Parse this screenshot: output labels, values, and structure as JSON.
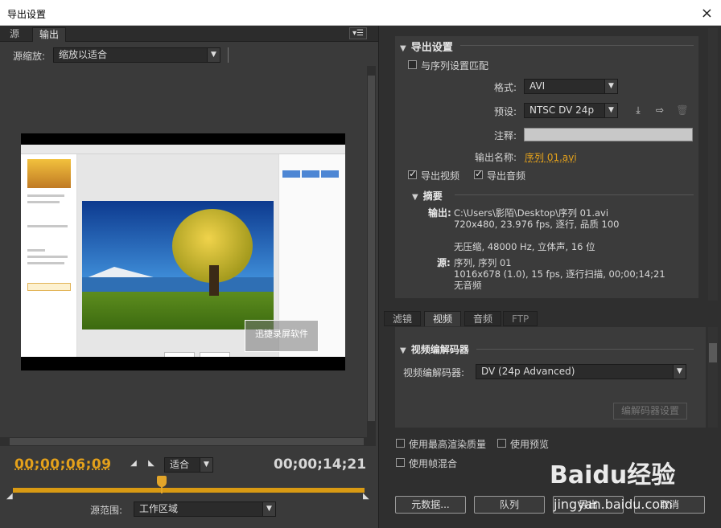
{
  "window": {
    "title": "导出设置",
    "close_glyph": "×"
  },
  "left": {
    "tabs": [
      "源",
      "输出"
    ],
    "active_tab": "输出",
    "menu_glyph": "▾☰",
    "source_scale_label": "源缩放:",
    "source_scale_value": "缩放以适合",
    "watermark_text": "迅捷录屏软件",
    "timecode_current": "00;00;06;09",
    "timecode_end": "00;00;14;21",
    "fit_value": "适合",
    "source_range_label": "源范围:",
    "source_range_value": "工作区域"
  },
  "export_settings": {
    "section_title": "导出设置",
    "match_sequence_label": "与序列设置匹配",
    "format_label": "格式:",
    "format_value": "AVI",
    "preset_label": "预设:",
    "preset_value": "NTSC DV 24p",
    "comment_label": "注释:",
    "output_name_label": "输出名称:",
    "output_name_value": "序列 01.avi",
    "export_video_label": "导出视频",
    "export_audio_label": "导出音频",
    "summary_title": "摘要",
    "output_key": "输出:",
    "output_lines": [
      "C:\\Users\\影陌\\Desktop\\序列 01.avi",
      "720x480, 23.976 fps, 逐行, 品质 100",
      "无压缩, 48000 Hz, 立体声, 16 位"
    ],
    "source_key": "源:",
    "source_lines": [
      "序列, 序列 01",
      "1016x678 (1.0), 15 fps, 逐行扫描, 00;00;14;21",
      "无音频"
    ]
  },
  "right_tabs": [
    "滤镜",
    "视频",
    "音频",
    "FTP"
  ],
  "right_active_tab": "视频",
  "video_codec": {
    "section_title": "视频编解码器",
    "codec_label": "视频编解码器:",
    "codec_value": "DV (24p Advanced)",
    "codec_settings_button": "编解码器设置"
  },
  "options": {
    "max_render_quality": "使用最高渲染质量",
    "use_preview": "使用预览",
    "frame_blending": "使用帧混合"
  },
  "buttons": {
    "metadata": "元数据...",
    "queue": "队列",
    "export": "导出",
    "cancel": "取消"
  },
  "watermark_site": {
    "logo": "Baidu经验",
    "url": "jingyan.baidu.com"
  },
  "icons": [
    "close-icon",
    "panel-menu-icon",
    "dropdown-arrow-icon",
    "save-preset-icon",
    "import-preset-icon",
    "delete-preset-icon",
    "collapse-triangle-icon",
    "mark-in-icon",
    "mark-out-icon",
    "playhead-icon"
  ]
}
